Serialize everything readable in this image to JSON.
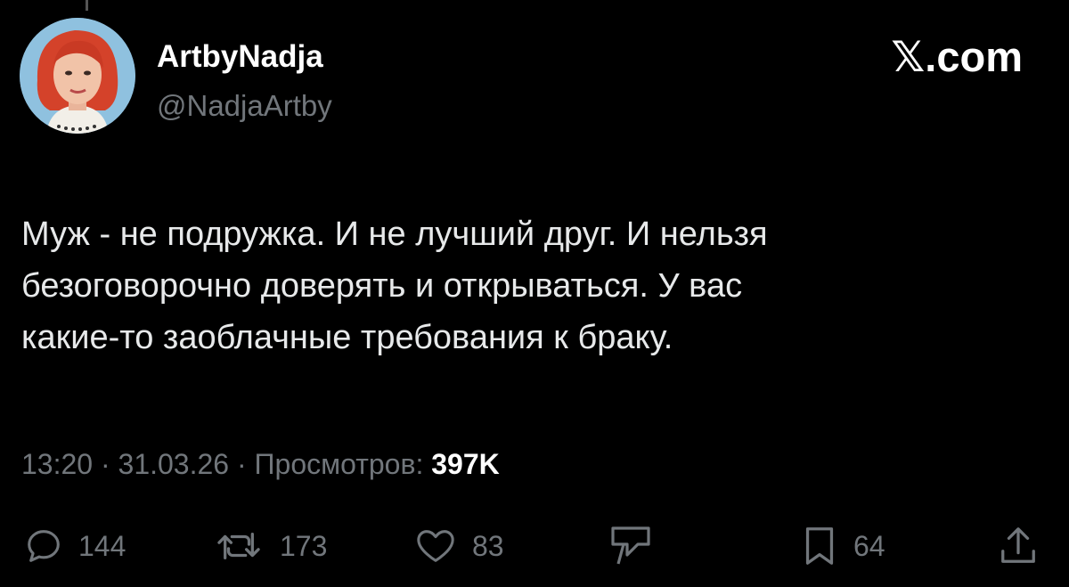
{
  "author": {
    "display_name": "ArtbyNadja",
    "handle": "@NadjaArtby",
    "avatar_icon": "profile-avatar"
  },
  "brand": "𝕏.com",
  "tweet": {
    "lines": [
      "Муж - не подружка. И не лучший друг. И нельзя",
      "безоговорочно доверять и открываться. У вас",
      "какие-то  заоблачные требования к браку."
    ],
    "time": "13:20",
    "date": "31.03.26",
    "views_label": "Просмотров:",
    "views_count": "397K"
  },
  "actions": {
    "reply_count": "144",
    "repost_count": "173",
    "like_count": "83",
    "bookmark_count": "64"
  },
  "colors": {
    "background": "#000000",
    "text": "#e7e9ea",
    "muted": "#71767b"
  }
}
